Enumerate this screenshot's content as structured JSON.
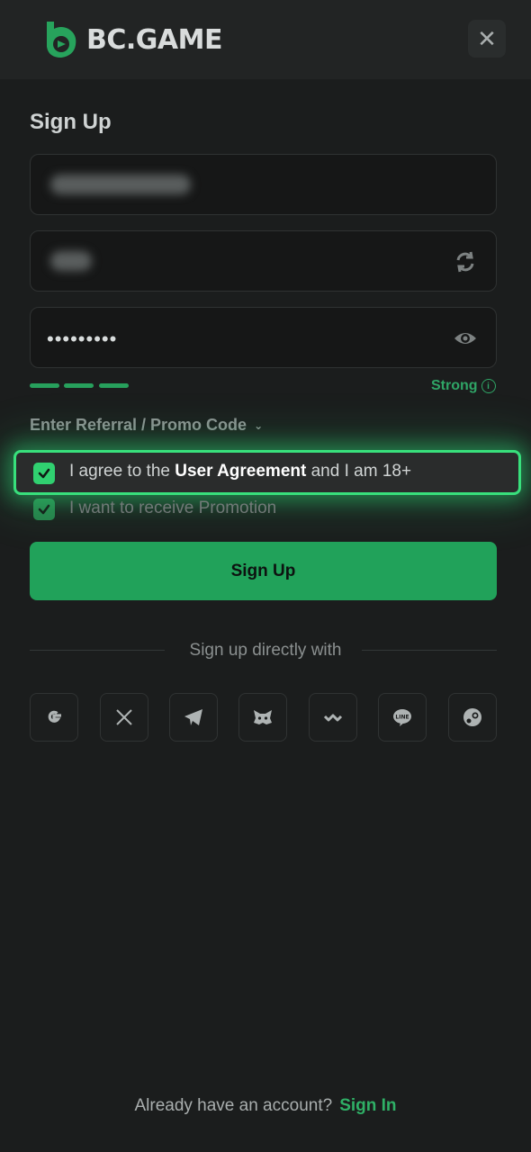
{
  "brand": {
    "name": "BC.GAME",
    "accent": "#21a25a",
    "highlight": "#38e07c"
  },
  "header": {
    "close_icon": "close-icon"
  },
  "form": {
    "title": "Sign Up",
    "password_masked": "•••••••••",
    "password_strength": "Strong",
    "strength_level": 3,
    "promo_label": "Enter Referral / Promo Code",
    "agree_prefix": "I agree to the ",
    "agree_link": "User Agreement",
    "agree_suffix": " and I am 18+",
    "agree_checked": true,
    "promotion_label": "I want to receive Promotion",
    "promotion_checked": true,
    "submit_label": "Sign Up"
  },
  "social": {
    "divider_text": "Sign up directly with",
    "providers": [
      "google",
      "x",
      "telegram",
      "metamask",
      "walletconnect",
      "line",
      "steam"
    ]
  },
  "footer": {
    "prompt": "Already have an account?",
    "link": "Sign In"
  }
}
